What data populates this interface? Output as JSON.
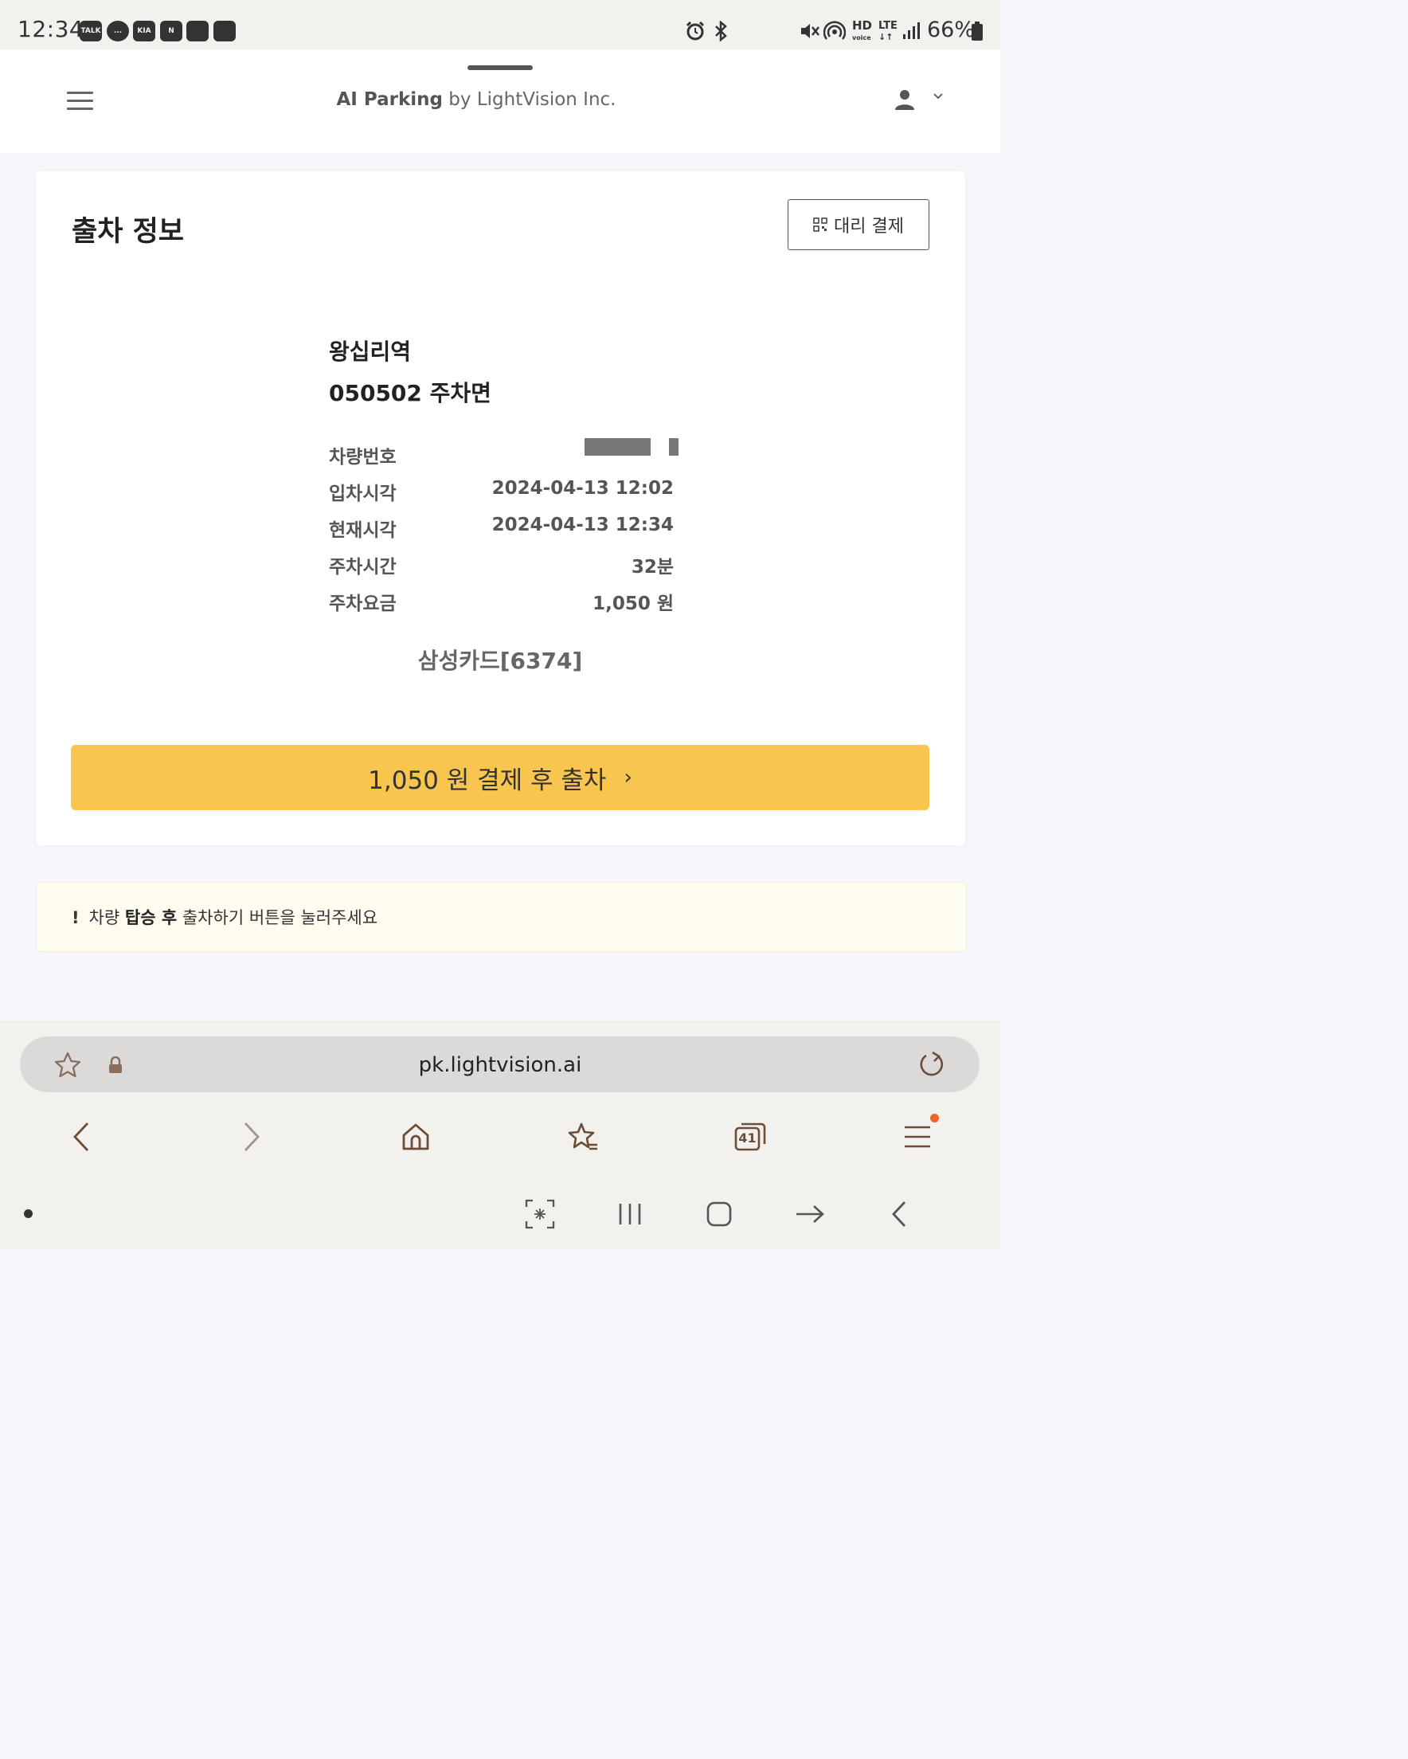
{
  "status_bar": {
    "time": "12:34",
    "notifications": [
      "TALK",
      "...",
      "KIA",
      "N",
      "",
      ""
    ],
    "battery": "66%",
    "right_icons": [
      "alarm-icon",
      "bluetooth-icon",
      "mute-icon",
      "hotspot-icon",
      "hd-voice-icon",
      "lte-icon",
      "signal-icon",
      "battery-icon"
    ]
  },
  "header": {
    "brand_bold": "AI Parking",
    "brand_rest": " by LightVision Inc."
  },
  "card": {
    "title": "출차 정보",
    "proxy_pay": "대리 결제",
    "lot_name": "왕십리역",
    "space": "050502 주차면",
    "rows": [
      {
        "label": "차량번호",
        "value": ""
      },
      {
        "label": "입차시각",
        "value": "2024-04-13 12:02"
      },
      {
        "label": "현재시각",
        "value": "2024-04-13 12:34"
      },
      {
        "label": "주차시간",
        "value": "32분"
      },
      {
        "label": "주차요금",
        "value": "1,050 원"
      }
    ],
    "payment_card": "삼성카드[6374]",
    "pay_button": "1,050 원 결제 후 출차",
    "pay_button_chevron": "›"
  },
  "notice": {
    "bang": "!",
    "pre": "차량 ",
    "bold": "탑승 후",
    "post": " 출차하기 버튼을 눌러주세요"
  },
  "browser": {
    "url": "pk.lightvision.ai",
    "tabs_count": "41"
  },
  "colors": {
    "accent": "#f8c64f",
    "notice_bg": "#fefbef",
    "badge": "#f0642a"
  }
}
